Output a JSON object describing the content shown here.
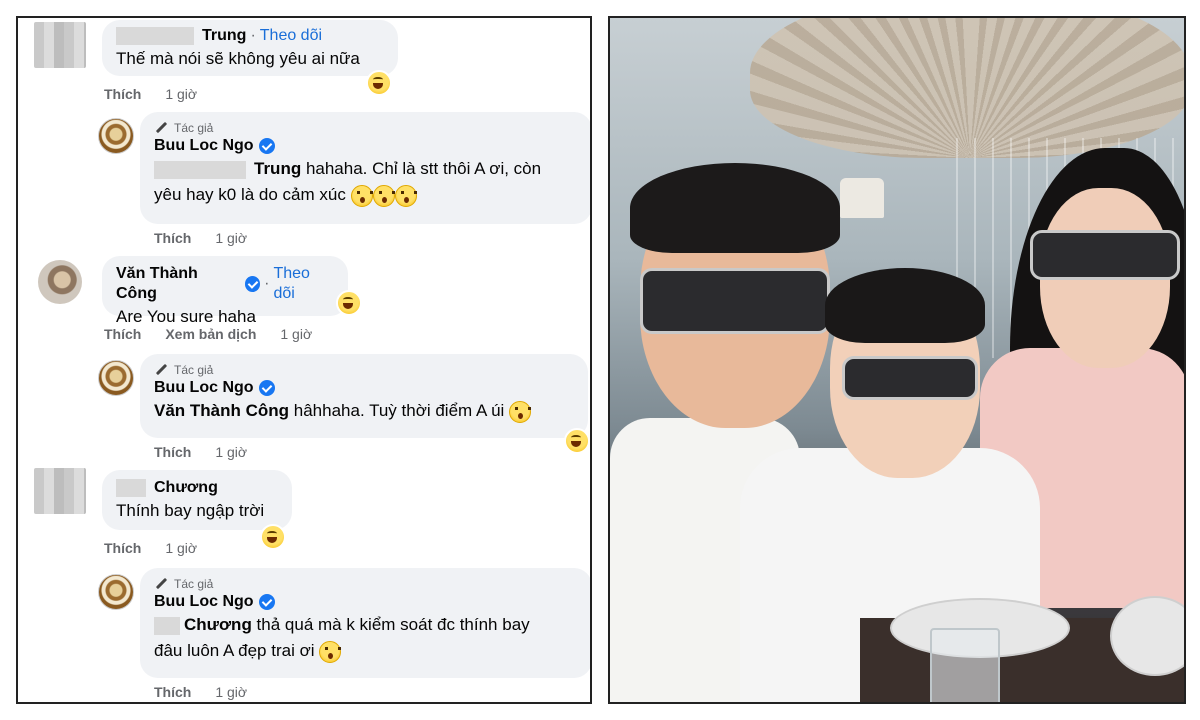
{
  "comments": [
    {
      "id": "c1",
      "name": "Trung",
      "follow_label": "Theo dõi",
      "text": "Thế mà nói sẽ không yêu ai nữa",
      "like_label": "Thích",
      "time": "1 giờ",
      "reaction": "haha"
    },
    {
      "id": "r1",
      "author_badge": "Tác giả",
      "name": "Buu Loc Ngo",
      "mention": "Trung",
      "text_line1": " hahaha. Chỉ là stt thôi A ơi, còn",
      "text_line2": "yêu hay k0 là do cảm xúc",
      "like_label": "Thích",
      "time": "1 giờ"
    },
    {
      "id": "c2",
      "name": "Văn Thành Công",
      "follow_label": "Theo dõi",
      "text": "Are You sure haha",
      "like_label": "Thích",
      "translate_label": "Xem bản dịch",
      "time": "1 giờ",
      "reaction": "haha"
    },
    {
      "id": "r2",
      "author_badge": "Tác giả",
      "name": "Buu Loc Ngo",
      "mention": "Văn Thành Công",
      "text": " hâhhaha. Tuỳ thời điểm A úi",
      "like_label": "Thích",
      "time": "1 giờ",
      "reaction": "haha"
    },
    {
      "id": "c3",
      "name": "Chương",
      "text": "Thính bay ngập trời",
      "like_label": "Thích",
      "time": "1 giờ",
      "reaction": "haha"
    },
    {
      "id": "r3",
      "author_badge": "Tác giả",
      "name": "Buu Loc Ngo",
      "mention": "Chương",
      "text_line1": " thả quá mà k kiểm soát đc thính bay",
      "text_line2": "đâu luôn A đẹp trai ơi",
      "like_label": "Thích",
      "time": "1 giờ"
    }
  ],
  "colors": {
    "link_blue": "#1a6ed8",
    "bubble_gray": "#f0f2f5",
    "meta_gray": "#65676b",
    "verified_blue": "#1877f2"
  },
  "icons": [
    "pencil-icon",
    "verified-badge-icon",
    "haha-reaction-icon",
    "wow-emoji-icon"
  ]
}
